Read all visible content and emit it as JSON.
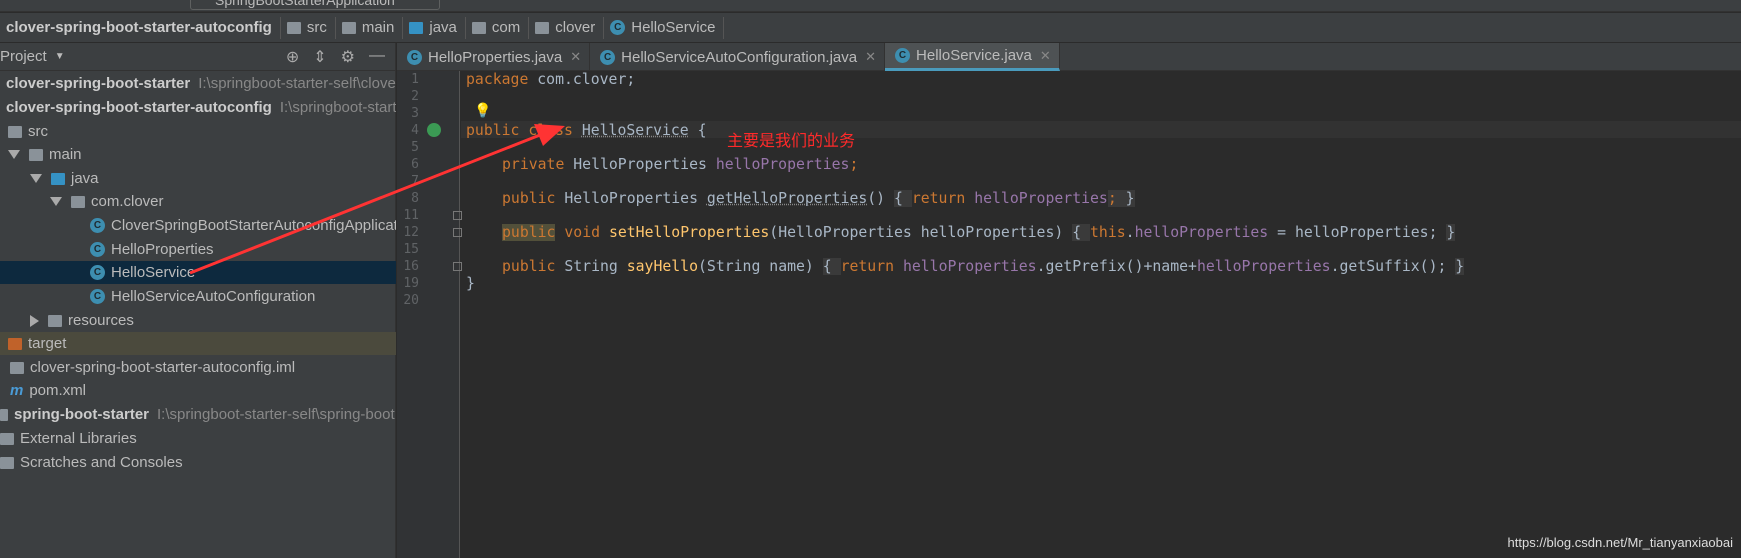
{
  "toolbar": {
    "run_config": "SpringBootStarterApplication"
  },
  "breadcrumb": [
    "clover-spring-boot-starter-autoconfig",
    "src",
    "main",
    "java",
    "com",
    "clover",
    "HelloService"
  ],
  "sidebar": {
    "title": "Project",
    "items": [
      {
        "label": "clover-spring-boot-starter",
        "path": "I:\\springboot-starter-self\\clover",
        "bold": true
      },
      {
        "label": "clover-spring-boot-starter-autoconfig",
        "path": "I:\\springboot-starter-self",
        "bold": true
      },
      {
        "label": "src"
      },
      {
        "label": "main"
      },
      {
        "label": "java"
      },
      {
        "label": "com.clover"
      },
      {
        "label": "CloverSpringBootStarterAutoconfigApplication"
      },
      {
        "label": "HelloProperties"
      },
      {
        "label": "HelloService"
      },
      {
        "label": "HelloServiceAutoConfiguration"
      },
      {
        "label": "resources"
      },
      {
        "label": "target"
      },
      {
        "label": "clover-spring-boot-starter-autoconfig.iml"
      },
      {
        "label": "pom.xml"
      },
      {
        "label": "spring-boot-starter",
        "path": "I:\\springboot-starter-self\\spring-boot",
        "bold": true
      },
      {
        "label": "External Libraries"
      },
      {
        "label": "Scratches and Consoles"
      }
    ]
  },
  "tabs": [
    {
      "label": "HelloProperties.java"
    },
    {
      "label": "HelloServiceAutoConfiguration.java"
    },
    {
      "label": "HelloService.java",
      "active": true
    }
  ],
  "gutter_lines": [
    "1",
    "2",
    "3",
    "4",
    "5",
    "6",
    "7",
    "8",
    "11",
    "12",
    "15",
    "16",
    "19",
    "20"
  ],
  "code": {
    "l1": [
      "package",
      " com.clover;"
    ],
    "l4": [
      "public class ",
      "HelloService",
      " {"
    ],
    "l6": [
      "private",
      " HelloProperties ",
      "helloProperties",
      ";"
    ],
    "l8": [
      "public",
      " HelloProperties ",
      "getHelloProperties",
      "() ",
      "{ ",
      "return",
      " ",
      "helloProperties",
      "; ",
      "}"
    ],
    "l12": [
      "public",
      " ",
      "void",
      " ",
      "setHelloProperties",
      "(HelloProperties helloProperties) ",
      "{ ",
      "this",
      ".",
      "helloProperties",
      " = helloProperties; ",
      "}"
    ],
    "l16": [
      "public",
      " String ",
      "sayHello",
      "(String name) ",
      "{ ",
      "return",
      " ",
      "helloProperties",
      ".getPrefix()+name+",
      "helloProperties",
      ".getSuffix(); ",
      "}"
    ],
    "l19": "}"
  },
  "annotation": "主要是我们的业务",
  "watermark": "https://blog.csdn.net/Mr_tianyanxiaobai",
  "colors": {
    "annotation": "#ff2a2a",
    "keyword": "#cc7832",
    "field": "#9876aa",
    "method": "#ffc66d"
  }
}
